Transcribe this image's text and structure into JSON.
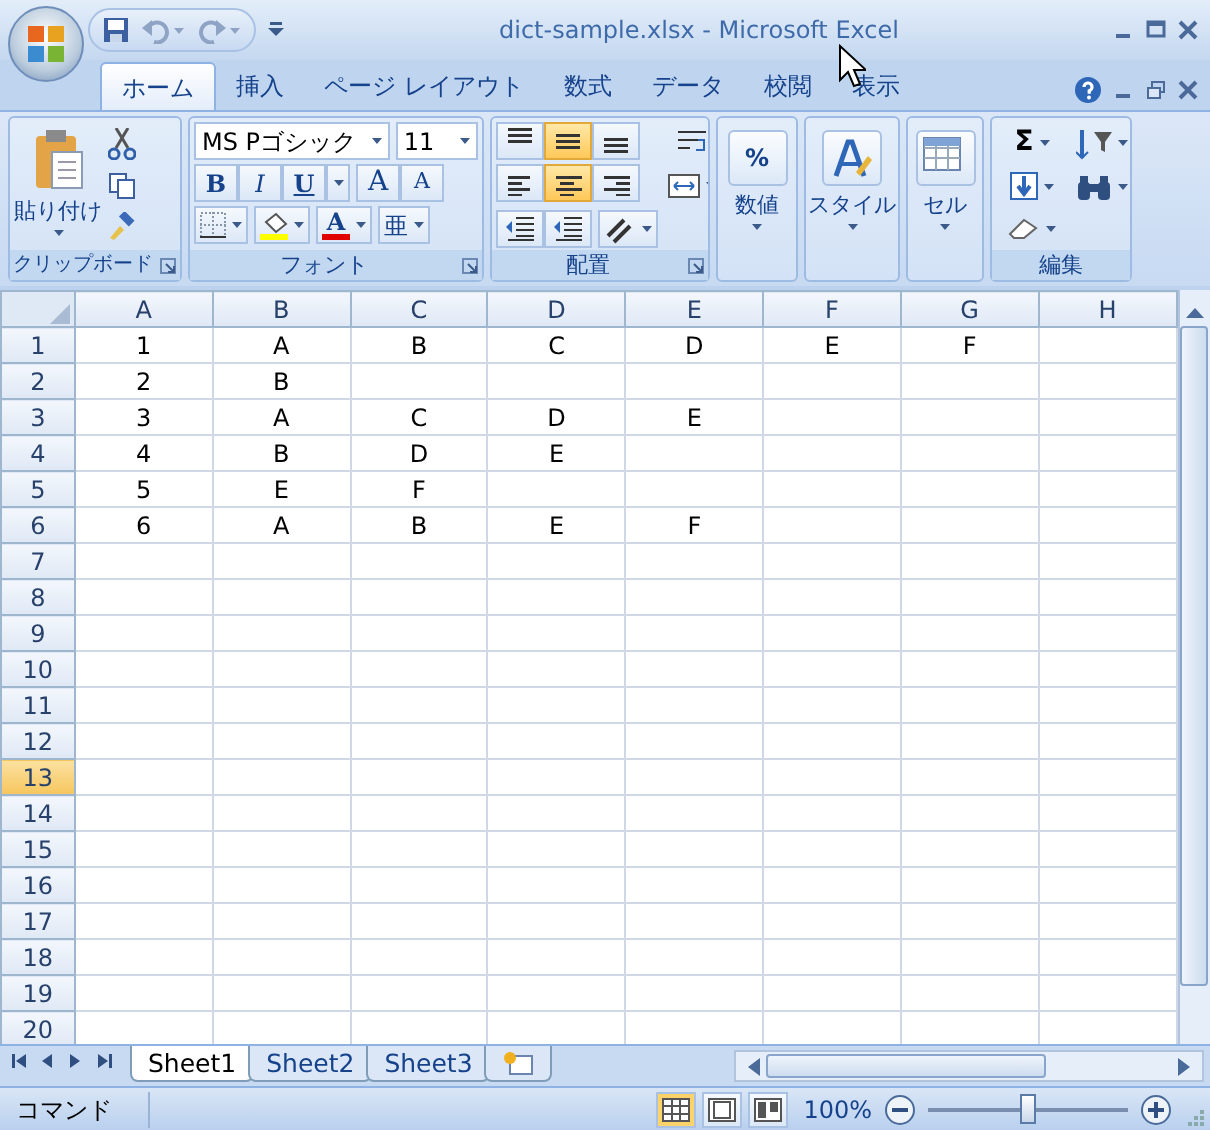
{
  "window": {
    "title": "dict-sample.xlsx - Microsoft Excel"
  },
  "ribbon_tabs": [
    {
      "label": "ホーム",
      "selected": true
    },
    {
      "label": "挿入",
      "selected": false
    },
    {
      "label": "ページ レイアウト",
      "selected": false
    },
    {
      "label": "数式",
      "selected": false
    },
    {
      "label": "データ",
      "selected": false
    },
    {
      "label": "校閲",
      "selected": false
    },
    {
      "label": "表示",
      "selected": false
    }
  ],
  "clipboard": {
    "paste": "貼り付け",
    "label": "クリップボード"
  },
  "font": {
    "name": "MS Pゴシック",
    "size": "11",
    "label": "フォント",
    "style_buttons": [
      {
        "label": "B",
        "kind": "bold"
      },
      {
        "label": "I",
        "kind": "italic"
      },
      {
        "label": "U",
        "kind": "underline"
      }
    ],
    "size_buttons": [
      {
        "label": "A",
        "kind": "grow"
      },
      {
        "label": "A",
        "kind": "shrink"
      }
    ],
    "font_color": {
      "label": "A",
      "color": "#e00000"
    },
    "fill_color": {
      "color": "#ffff00"
    },
    "phonetic": "亜"
  },
  "alignment": {
    "label": "配置",
    "vertical": [
      {
        "kind": "top",
        "selected": false
      },
      {
        "kind": "middle",
        "selected": true
      },
      {
        "kind": "bottom",
        "selected": false
      }
    ],
    "horizontal": [
      {
        "kind": "left",
        "selected": false
      },
      {
        "kind": "center",
        "selected": true
      },
      {
        "kind": "right",
        "selected": false
      }
    ]
  },
  "big_groups": [
    {
      "label": "数値",
      "symbol": "%"
    },
    {
      "label": "スタイル"
    },
    {
      "label": "セル"
    }
  ],
  "editing": {
    "label": "編集",
    "sum": "Σ"
  },
  "grid": {
    "columns": [
      "A",
      "B",
      "C",
      "D",
      "E",
      "F",
      "G",
      "H"
    ],
    "rows": [
      {
        "header": "1",
        "selected": false,
        "cells": [
          "1",
          "A",
          "B",
          "C",
          "D",
          "E",
          "F"
        ]
      },
      {
        "header": "2",
        "selected": false,
        "cells": [
          "2",
          "B"
        ]
      },
      {
        "header": "3",
        "selected": false,
        "cells": [
          "3",
          "A",
          "C",
          "D",
          "E"
        ]
      },
      {
        "header": "4",
        "selected": false,
        "cells": [
          "4",
          "B",
          "D",
          "E"
        ]
      },
      {
        "header": "5",
        "selected": false,
        "cells": [
          "5",
          "E",
          "F"
        ]
      },
      {
        "header": "6",
        "selected": false,
        "cells": [
          "6",
          "A",
          "B",
          "E",
          "F"
        ]
      },
      {
        "header": "7",
        "selected": false
      },
      {
        "header": "8",
        "selected": false
      },
      {
        "header": "9",
        "selected": false
      },
      {
        "header": "10",
        "selected": false
      },
      {
        "header": "11",
        "selected": false
      },
      {
        "header": "12",
        "selected": false
      },
      {
        "header": "13",
        "selected": true
      },
      {
        "header": "14",
        "selected": false
      },
      {
        "header": "15",
        "selected": false
      },
      {
        "header": "16",
        "selected": false
      },
      {
        "header": "17",
        "selected": false
      },
      {
        "header": "18",
        "selected": false
      },
      {
        "header": "19",
        "selected": false
      },
      {
        "header": "20",
        "selected": false
      }
    ]
  },
  "sheets": [
    {
      "label": "Sheet1",
      "selected": true
    },
    {
      "label": "Sheet2",
      "selected": false
    },
    {
      "label": "Sheet3",
      "selected": false
    }
  ],
  "status_bar": {
    "mode": "コマンド",
    "zoom": "100%",
    "zoom_slider": {
      "level": 0.5
    }
  }
}
